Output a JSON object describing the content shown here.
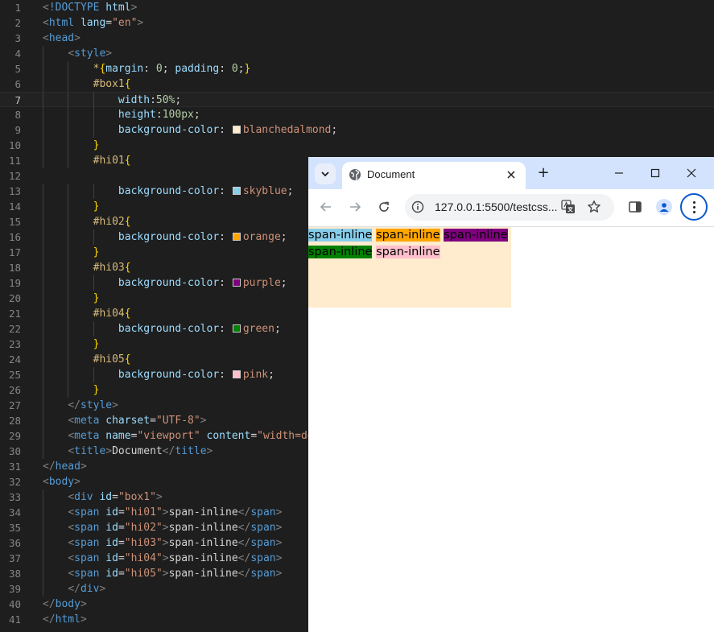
{
  "editor": {
    "lines": [
      [
        [
          "t-punct",
          "<"
        ],
        [
          "t-doctype",
          "!DOCTYPE"
        ],
        [
          "t-text",
          " "
        ],
        [
          "t-attr",
          "html"
        ],
        [
          "t-punct",
          ">"
        ]
      ],
      [
        [
          "t-punct",
          "<"
        ],
        [
          "t-tag",
          "html"
        ],
        [
          "t-text",
          " "
        ],
        [
          "t-attr",
          "lang"
        ],
        [
          "t-text",
          "="
        ],
        [
          "t-str",
          "\"en\""
        ],
        [
          "t-punct",
          ">"
        ]
      ],
      [
        [
          "t-punct",
          "<"
        ],
        [
          "t-tag",
          "head"
        ],
        [
          "t-punct",
          ">"
        ]
      ],
      [
        [
          "t-text",
          "    "
        ],
        [
          "t-punct",
          "<"
        ],
        [
          "t-tag",
          "style"
        ],
        [
          "t-punct",
          ">"
        ]
      ],
      [
        [
          "t-text",
          "        "
        ],
        [
          "t-sel",
          "*"
        ],
        [
          "t-brace",
          "{"
        ],
        [
          "t-prop",
          "margin"
        ],
        [
          "t-text",
          ": "
        ],
        [
          "t-num",
          "0"
        ],
        [
          "t-text",
          "; "
        ],
        [
          "t-prop",
          "padding"
        ],
        [
          "t-text",
          ": "
        ],
        [
          "t-num",
          "0"
        ],
        [
          "t-text",
          ";"
        ],
        [
          "t-brace",
          "}"
        ]
      ],
      [
        [
          "t-text",
          "        "
        ],
        [
          "t-sel",
          "#box1"
        ],
        [
          "t-brace",
          "{"
        ]
      ],
      [
        [
          "t-text",
          "            "
        ],
        [
          "t-prop",
          "width"
        ],
        [
          "t-text",
          ":"
        ],
        [
          "t-num",
          "50%"
        ],
        [
          "t-text",
          ";"
        ]
      ],
      [
        [
          "t-text",
          "            "
        ],
        [
          "t-prop",
          "height"
        ],
        [
          "t-text",
          ":"
        ],
        [
          "t-num",
          "100px"
        ],
        [
          "t-text",
          ";"
        ]
      ],
      [
        [
          "t-text",
          "            "
        ],
        [
          "t-prop",
          "background-color"
        ],
        [
          "t-text",
          ": "
        ],
        [
          "swatch",
          "#ffebcd"
        ],
        [
          "t-val",
          "blanchedalmond"
        ],
        [
          "t-text",
          ";"
        ]
      ],
      [
        [
          "t-text",
          "        "
        ],
        [
          "t-brace",
          "}"
        ]
      ],
      [
        [
          "t-text",
          "        "
        ],
        [
          "t-sel",
          "#hi01"
        ],
        [
          "t-brace",
          "{"
        ]
      ],
      [],
      [
        [
          "t-text",
          "            "
        ],
        [
          "t-prop",
          "background-color"
        ],
        [
          "t-text",
          ": "
        ],
        [
          "swatch",
          "#87ceeb"
        ],
        [
          "t-val",
          "skyblue"
        ],
        [
          "t-text",
          ";"
        ]
      ],
      [
        [
          "t-text",
          "        "
        ],
        [
          "t-brace",
          "}"
        ]
      ],
      [
        [
          "t-text",
          "        "
        ],
        [
          "t-sel",
          "#hi02"
        ],
        [
          "t-brace",
          "{"
        ]
      ],
      [
        [
          "t-text",
          "            "
        ],
        [
          "t-prop",
          "background-color"
        ],
        [
          "t-text",
          ": "
        ],
        [
          "swatch",
          "#ffa500"
        ],
        [
          "t-val",
          "orange"
        ],
        [
          "t-text",
          ";"
        ]
      ],
      [
        [
          "t-text",
          "        "
        ],
        [
          "t-brace",
          "}"
        ]
      ],
      [
        [
          "t-text",
          "        "
        ],
        [
          "t-sel",
          "#hi03"
        ],
        [
          "t-brace",
          "{"
        ]
      ],
      [
        [
          "t-text",
          "            "
        ],
        [
          "t-prop",
          "background-color"
        ],
        [
          "t-text",
          ": "
        ],
        [
          "swatch",
          "#800080"
        ],
        [
          "t-val",
          "purple"
        ],
        [
          "t-text",
          ";"
        ]
      ],
      [
        [
          "t-text",
          "        "
        ],
        [
          "t-brace",
          "}"
        ]
      ],
      [
        [
          "t-text",
          "        "
        ],
        [
          "t-sel",
          "#hi04"
        ],
        [
          "t-brace",
          "{"
        ]
      ],
      [
        [
          "t-text",
          "            "
        ],
        [
          "t-prop",
          "background-color"
        ],
        [
          "t-text",
          ": "
        ],
        [
          "swatch",
          "#008000"
        ],
        [
          "t-val",
          "green"
        ],
        [
          "t-text",
          ";"
        ]
      ],
      [
        [
          "t-text",
          "        "
        ],
        [
          "t-brace",
          "}"
        ]
      ],
      [
        [
          "t-text",
          "        "
        ],
        [
          "t-sel",
          "#hi05"
        ],
        [
          "t-brace",
          "{"
        ]
      ],
      [
        [
          "t-text",
          "            "
        ],
        [
          "t-prop",
          "background-color"
        ],
        [
          "t-text",
          ": "
        ],
        [
          "swatch",
          "#ffc0cb"
        ],
        [
          "t-val",
          "pink"
        ],
        [
          "t-text",
          ";"
        ]
      ],
      [
        [
          "t-text",
          "        "
        ],
        [
          "t-brace",
          "}"
        ]
      ],
      [
        [
          "t-text",
          "    "
        ],
        [
          "t-punct",
          "</"
        ],
        [
          "t-tag",
          "style"
        ],
        [
          "t-punct",
          ">"
        ]
      ],
      [
        [
          "t-text",
          "    "
        ],
        [
          "t-punct",
          "<"
        ],
        [
          "t-tag",
          "meta"
        ],
        [
          "t-text",
          " "
        ],
        [
          "t-attr",
          "charset"
        ],
        [
          "t-text",
          "="
        ],
        [
          "t-str",
          "\"UTF-8\""
        ],
        [
          "t-punct",
          ">"
        ]
      ],
      [
        [
          "t-text",
          "    "
        ],
        [
          "t-punct",
          "<"
        ],
        [
          "t-tag",
          "meta"
        ],
        [
          "t-text",
          " "
        ],
        [
          "t-attr",
          "name"
        ],
        [
          "t-text",
          "="
        ],
        [
          "t-str",
          "\"viewport\""
        ],
        [
          "t-text",
          " "
        ],
        [
          "t-attr",
          "content"
        ],
        [
          "t-text",
          "="
        ],
        [
          "t-str",
          "\"width=de"
        ]
      ],
      [
        [
          "t-text",
          "    "
        ],
        [
          "t-punct",
          "<"
        ],
        [
          "t-tag",
          "title"
        ],
        [
          "t-punct",
          ">"
        ],
        [
          "t-text",
          "Document"
        ],
        [
          "t-punct",
          "</"
        ],
        [
          "t-tag",
          "title"
        ],
        [
          "t-punct",
          ">"
        ]
      ],
      [
        [
          "t-punct",
          "</"
        ],
        [
          "t-tag",
          "head"
        ],
        [
          "t-punct",
          ">"
        ]
      ],
      [
        [
          "t-punct",
          "<"
        ],
        [
          "t-tag",
          "body"
        ],
        [
          "t-punct",
          ">"
        ]
      ],
      [
        [
          "t-text",
          "    "
        ],
        [
          "t-punct",
          "<"
        ],
        [
          "t-tag",
          "div"
        ],
        [
          "t-text",
          " "
        ],
        [
          "t-attr",
          "id"
        ],
        [
          "t-text",
          "="
        ],
        [
          "t-str",
          "\"box1\""
        ],
        [
          "t-punct",
          ">"
        ]
      ],
      [
        [
          "t-text",
          "    "
        ],
        [
          "t-punct",
          "<"
        ],
        [
          "t-tag",
          "span"
        ],
        [
          "t-text",
          " "
        ],
        [
          "t-attr",
          "id"
        ],
        [
          "t-text",
          "="
        ],
        [
          "t-str",
          "\"hi01\""
        ],
        [
          "t-punct",
          ">"
        ],
        [
          "t-text",
          "span-inline"
        ],
        [
          "t-punct",
          "</"
        ],
        [
          "t-tag",
          "span"
        ],
        [
          "t-punct",
          ">"
        ]
      ],
      [
        [
          "t-text",
          "    "
        ],
        [
          "t-punct",
          "<"
        ],
        [
          "t-tag",
          "span"
        ],
        [
          "t-text",
          " "
        ],
        [
          "t-attr",
          "id"
        ],
        [
          "t-text",
          "="
        ],
        [
          "t-str",
          "\"hi02\""
        ],
        [
          "t-punct",
          ">"
        ],
        [
          "t-text",
          "span-inline"
        ],
        [
          "t-punct",
          "</"
        ],
        [
          "t-tag",
          "span"
        ],
        [
          "t-punct",
          ">"
        ]
      ],
      [
        [
          "t-text",
          "    "
        ],
        [
          "t-punct",
          "<"
        ],
        [
          "t-tag",
          "span"
        ],
        [
          "t-text",
          " "
        ],
        [
          "t-attr",
          "id"
        ],
        [
          "t-text",
          "="
        ],
        [
          "t-str",
          "\"hi03\""
        ],
        [
          "t-punct",
          ">"
        ],
        [
          "t-text",
          "span-inline"
        ],
        [
          "t-punct",
          "</"
        ],
        [
          "t-tag",
          "span"
        ],
        [
          "t-punct",
          ">"
        ]
      ],
      [
        [
          "t-text",
          "    "
        ],
        [
          "t-punct",
          "<"
        ],
        [
          "t-tag",
          "span"
        ],
        [
          "t-text",
          " "
        ],
        [
          "t-attr",
          "id"
        ],
        [
          "t-text",
          "="
        ],
        [
          "t-str",
          "\"hi04\""
        ],
        [
          "t-punct",
          ">"
        ],
        [
          "t-text",
          "span-inline"
        ],
        [
          "t-punct",
          "</"
        ],
        [
          "t-tag",
          "span"
        ],
        [
          "t-punct",
          ">"
        ]
      ],
      [
        [
          "t-text",
          "    "
        ],
        [
          "t-punct",
          "<"
        ],
        [
          "t-tag",
          "span"
        ],
        [
          "t-text",
          " "
        ],
        [
          "t-attr",
          "id"
        ],
        [
          "t-text",
          "="
        ],
        [
          "t-str",
          "\"hi05\""
        ],
        [
          "t-punct",
          ">"
        ],
        [
          "t-text",
          "span-inline"
        ],
        [
          "t-punct",
          "</"
        ],
        [
          "t-tag",
          "span"
        ],
        [
          "t-punct",
          ">"
        ]
      ],
      [
        [
          "t-text",
          "    "
        ],
        [
          "t-punct",
          "</"
        ],
        [
          "t-tag",
          "div"
        ],
        [
          "t-punct",
          ">"
        ]
      ],
      [
        [
          "t-punct",
          "</"
        ],
        [
          "t-tag",
          "body"
        ],
        [
          "t-punct",
          ">"
        ]
      ],
      [
        [
          "t-punct",
          "</"
        ],
        [
          "t-tag",
          "html"
        ],
        [
          "t-punct",
          ">"
        ]
      ]
    ],
    "current_line": 7,
    "colors": {
      "background": "#1e1e1e",
      "line_number": "#858585"
    }
  },
  "browser": {
    "tab": {
      "title": "Document",
      "globe_icon": "globe-icon",
      "close_icon": "close-icon"
    },
    "tab_search_icon": "chevron-down-icon",
    "new_tab_label": "+",
    "window_controls": [
      "minimize-icon",
      "maximize-icon",
      "close-icon"
    ],
    "toolbar": {
      "url": "127.0.0.1:5500/testcss...",
      "icons": [
        "back-icon",
        "forward-icon",
        "reload-icon",
        "info-icon",
        "translate-icon",
        "star-icon",
        "side-panel-icon",
        "profile-icon",
        "menu-icon"
      ]
    },
    "colors": {
      "tabbar": "#d3e3fd",
      "accent": "#0b57d0"
    },
    "page": {
      "box1_background": "#ffebcd",
      "spans": [
        {
          "id": "hi01",
          "text": "span-inline",
          "background": "#87ceeb"
        },
        {
          "id": "hi02",
          "text": "span-inline",
          "background": "#ffa500"
        },
        {
          "id": "hi03",
          "text": "span-inline",
          "background": "#800080"
        },
        {
          "id": "hi04",
          "text": "span-inline",
          "background": "#008000"
        },
        {
          "id": "hi05",
          "text": "span-inline",
          "background": "#ffc0cb"
        }
      ]
    }
  }
}
